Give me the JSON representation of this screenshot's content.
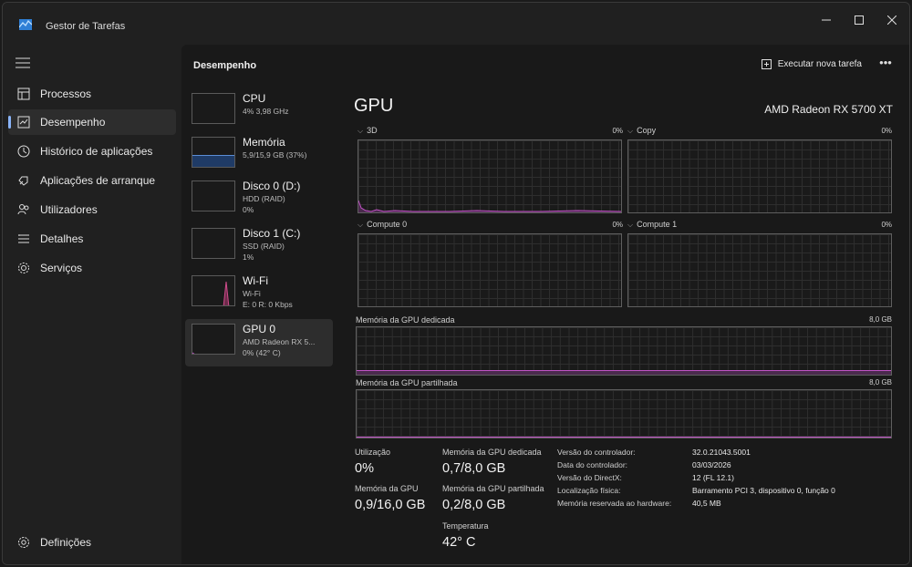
{
  "window": {
    "title": "Gestor de Tarefas",
    "controls": [
      "minimize",
      "maximize",
      "close"
    ]
  },
  "sidebar": {
    "items": [
      {
        "label": "Processos",
        "icon": "processes-icon",
        "active": false
      },
      {
        "label": "Desempenho",
        "icon": "performance-icon",
        "active": true
      },
      {
        "label": "Histórico de aplicações",
        "icon": "app-history-icon",
        "active": false
      },
      {
        "label": "Aplicações de arranque",
        "icon": "startup-apps-icon",
        "active": false
      },
      {
        "label": "Utilizadores",
        "icon": "users-icon",
        "active": false
      },
      {
        "label": "Detalhes",
        "icon": "details-icon",
        "active": false
      },
      {
        "label": "Serviços",
        "icon": "services-icon",
        "active": false
      }
    ],
    "settings_label": "Definições"
  },
  "header": {
    "title": "Desempenho",
    "run_task_label": "Executar nova tarefa",
    "more_label": "•••"
  },
  "devices": [
    {
      "name": "CPU",
      "lines": [
        "4%  3,98 GHz"
      ],
      "active": false
    },
    {
      "name": "Memória",
      "lines": [
        "5,9/15,9 GB (37%)"
      ],
      "active": false
    },
    {
      "name": "Disco 0 (D:)",
      "lines": [
        "HDD (RAID)",
        "0%"
      ],
      "active": false
    },
    {
      "name": "Disco 1 (C:)",
      "lines": [
        "SSD (RAID)",
        "1%"
      ],
      "active": false
    },
    {
      "name": "Wi-Fi",
      "lines": [
        "Wi-Fi",
        "E: 0  R: 0 Kbps"
      ],
      "active": false
    },
    {
      "name": "GPU 0",
      "lines": [
        "AMD Radeon RX 5...",
        "0% (42° C)"
      ],
      "active": true
    }
  ],
  "gpu": {
    "title": "GPU",
    "model": "AMD Radeon RX 5700 XT",
    "engines": [
      {
        "label": "3D",
        "percent": "0%"
      },
      {
        "label": "Copy",
        "percent": "0%"
      },
      {
        "label": "Compute 0",
        "percent": "0%"
      },
      {
        "label": "Compute 1",
        "percent": "0%"
      }
    ],
    "dedicated_memory": {
      "label": "Memória da GPU dedicada",
      "max": "8,0 GB",
      "fill_fraction": 0.09
    },
    "shared_memory": {
      "label": "Memória da GPU partilhada",
      "max": "8,0 GB",
      "fill_fraction": 0.0
    },
    "stats": {
      "utilization_label": "Utilização",
      "utilization_value": "0%",
      "gpu_memory_label": "Memória da GPU",
      "gpu_memory_value": "0,9/16,0 GB",
      "dedicated_label": "Memória da GPU dedicada",
      "dedicated_value": "0,7/8,0 GB",
      "shared_label": "Memória da GPU partilhada",
      "shared_value": "0,2/8,0 GB",
      "temperature_label": "Temperatura",
      "temperature_value": "42° C"
    },
    "details": [
      {
        "key": "Versão do controlador:",
        "value": "32.0.21043.5001"
      },
      {
        "key": "Data do controlador:",
        "value": "03/03/2026"
      },
      {
        "key": "Versão do DirectX:",
        "value": "12 (FL 12.1)"
      },
      {
        "key": "Localização física:",
        "value": "Barramento PCI 3, dispositivo 0, função 0"
      },
      {
        "key": "Memória reservada ao hardware:",
        "value": "40,5 MB"
      }
    ]
  },
  "colors": {
    "accent": "#8ab4f8",
    "gpu_graph": "#c153c6",
    "memory_graph": "#5b8dd6",
    "wifi_graph": "#d04c8c"
  }
}
